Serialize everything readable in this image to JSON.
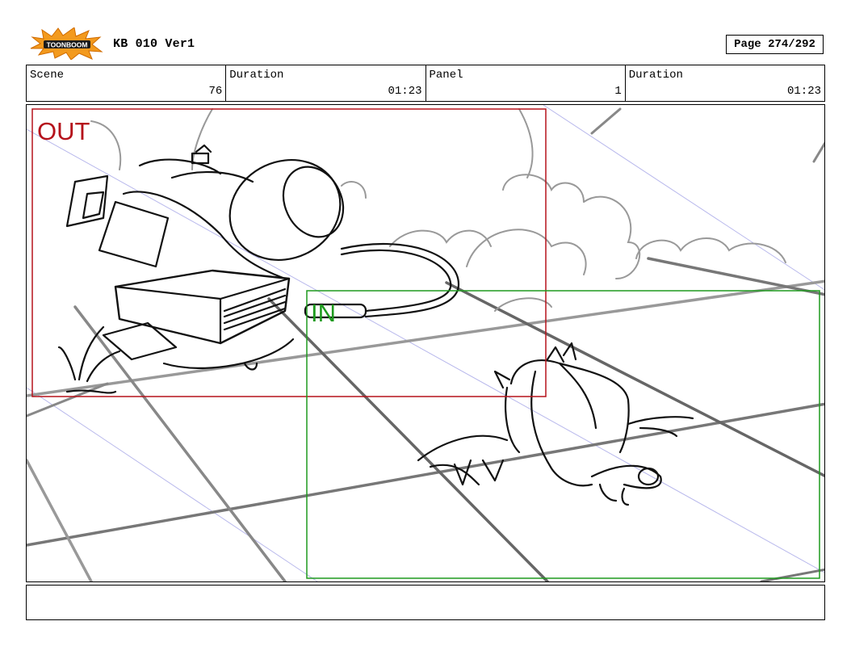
{
  "header": {
    "logo_text": "TOONBOOM",
    "title": "KB 010 Ver1",
    "page": "Page 274/292"
  },
  "info": {
    "scene_label": "Scene",
    "scene_value": "76",
    "duration_label": "Duration",
    "duration_value": "01:23",
    "panel_label": "Panel",
    "panel_value": "1",
    "duration2_label": "Duration",
    "duration2_value": "01:23"
  },
  "frames": {
    "out_label": "OUT",
    "in_label": "IN",
    "out_color": "#b5121b",
    "in_color": "#1e9a1e"
  },
  "notes": ""
}
